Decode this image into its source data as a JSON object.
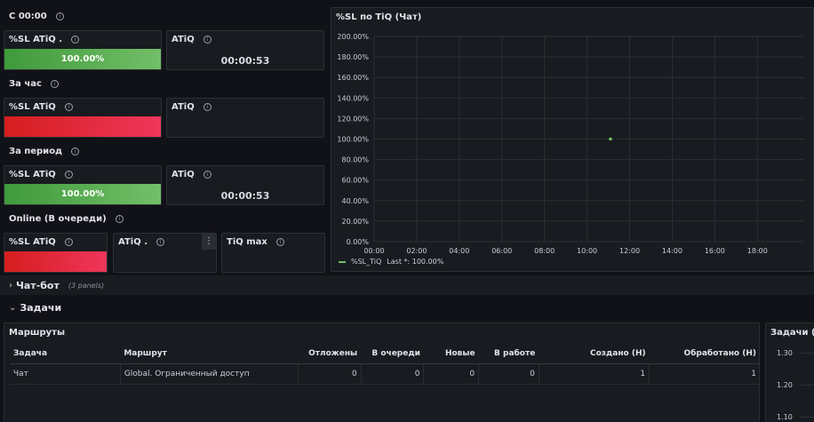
{
  "sections": {
    "s1": "С 00:00",
    "s2": "За час",
    "s3": "За период",
    "s4": "Online (В очереди)"
  },
  "stats": {
    "p1a_title": "%SL ATiQ .",
    "p1a_value": "100.00%",
    "p1b_title": "ATiQ",
    "p1b_value": "00:00:53",
    "p2a_title": "%SL ATiQ",
    "p2b_title": "ATiQ",
    "p3a_title": "%SL ATiQ",
    "p3a_value": "100.00%",
    "p3b_title": "ATiQ",
    "p3b_value": "00:00:53",
    "p4a_title": "%SL ATiQ",
    "p4b_title": "ATiQ .",
    "p4b_menu": "⋮",
    "p4c_title": "TiQ max"
  },
  "colors": {
    "green": "#73bf69",
    "red": "#f2365b",
    "series": "#73bf69"
  },
  "chart_panel": {
    "title": "%SL по TiQ (Чат)",
    "legend_series": "%SL_TiQ",
    "legend_last": "Last *: 100.00%"
  },
  "chart_data": {
    "type": "scatter",
    "title": "%SL по TiQ (Чат)",
    "yticks": [
      "200.00%",
      "180.00%",
      "160.00%",
      "140.00%",
      "120.00%",
      "100.00%",
      "80.00%",
      "60.00%",
      "40.00%",
      "20.00%",
      "0.00%"
    ],
    "xticks": [
      "00:00",
      "02:00",
      "04:00",
      "06:00",
      "08:00",
      "10:00",
      "12:00",
      "14:00",
      "16:00",
      "18:00"
    ],
    "ylim": [
      0,
      200
    ],
    "xlim_hours": [
      0,
      20.2
    ],
    "series": [
      {
        "name": "%SL_TiQ",
        "points": [
          {
            "x_hours": 11.1,
            "y": 100
          }
        ]
      }
    ],
    "grid": true,
    "legend": "bottom-left"
  },
  "rows": {
    "chatbot_label": "Чат-бот",
    "chatbot_sub": "(3 panels)",
    "tasks_label": "Задачи"
  },
  "routes": {
    "title": "Маршруты",
    "columns": [
      "Задача",
      "Маршрут",
      "Отложены",
      "В очереди",
      "Новые",
      "В работе",
      "Создано (H)",
      "Обработано (H)"
    ],
    "rows": [
      [
        "Чат",
        "Global. Ограниченный доступ",
        "0",
        "0",
        "0",
        "0",
        "1",
        "1"
      ]
    ]
  },
  "right_panel": {
    "title": "Задачи (Ча",
    "yticks": [
      "1.30",
      "1.20",
      "1.10"
    ]
  }
}
